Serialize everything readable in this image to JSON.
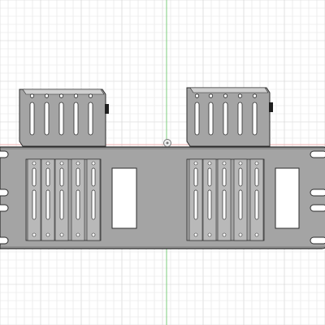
{
  "viewport": {
    "background": "#ffffff",
    "grid_minor_color": "#e3e3e3",
    "grid_major_color": "#cfcfcf",
    "axis_vertical_color": "#7ccd7c",
    "axis_horizontal_color": "#f2b3b3"
  },
  "model": {
    "body_fill": "#a4a4a4",
    "edge_color": "#2b2b2b",
    "highlight_fill": "#cfcfcf",
    "slot_fill": "#ffffff",
    "origin_marker_icon": "origin-marker-icon"
  }
}
